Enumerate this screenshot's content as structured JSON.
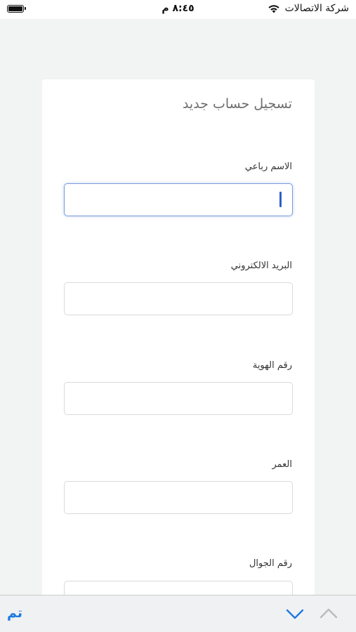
{
  "status_bar": {
    "carrier": "شركة الاتصالات",
    "time": "٨:٤٥ م"
  },
  "form": {
    "title": "تسجيل حساب جديد",
    "fields": [
      {
        "label": "الاسم رباعي",
        "value": "",
        "focused": true
      },
      {
        "label": "البريد الالكتروني",
        "value": ""
      },
      {
        "label": "رقم الهوية",
        "value": ""
      },
      {
        "label": "العمر",
        "value": ""
      },
      {
        "label": "رقم الجوال",
        "value": ""
      }
    ]
  },
  "accessory_bar": {
    "done_label": "تم",
    "next_icon": "chevron-down-icon",
    "previous_icon": "chevron-up-icon",
    "accent_color": "#1f7ae0"
  }
}
